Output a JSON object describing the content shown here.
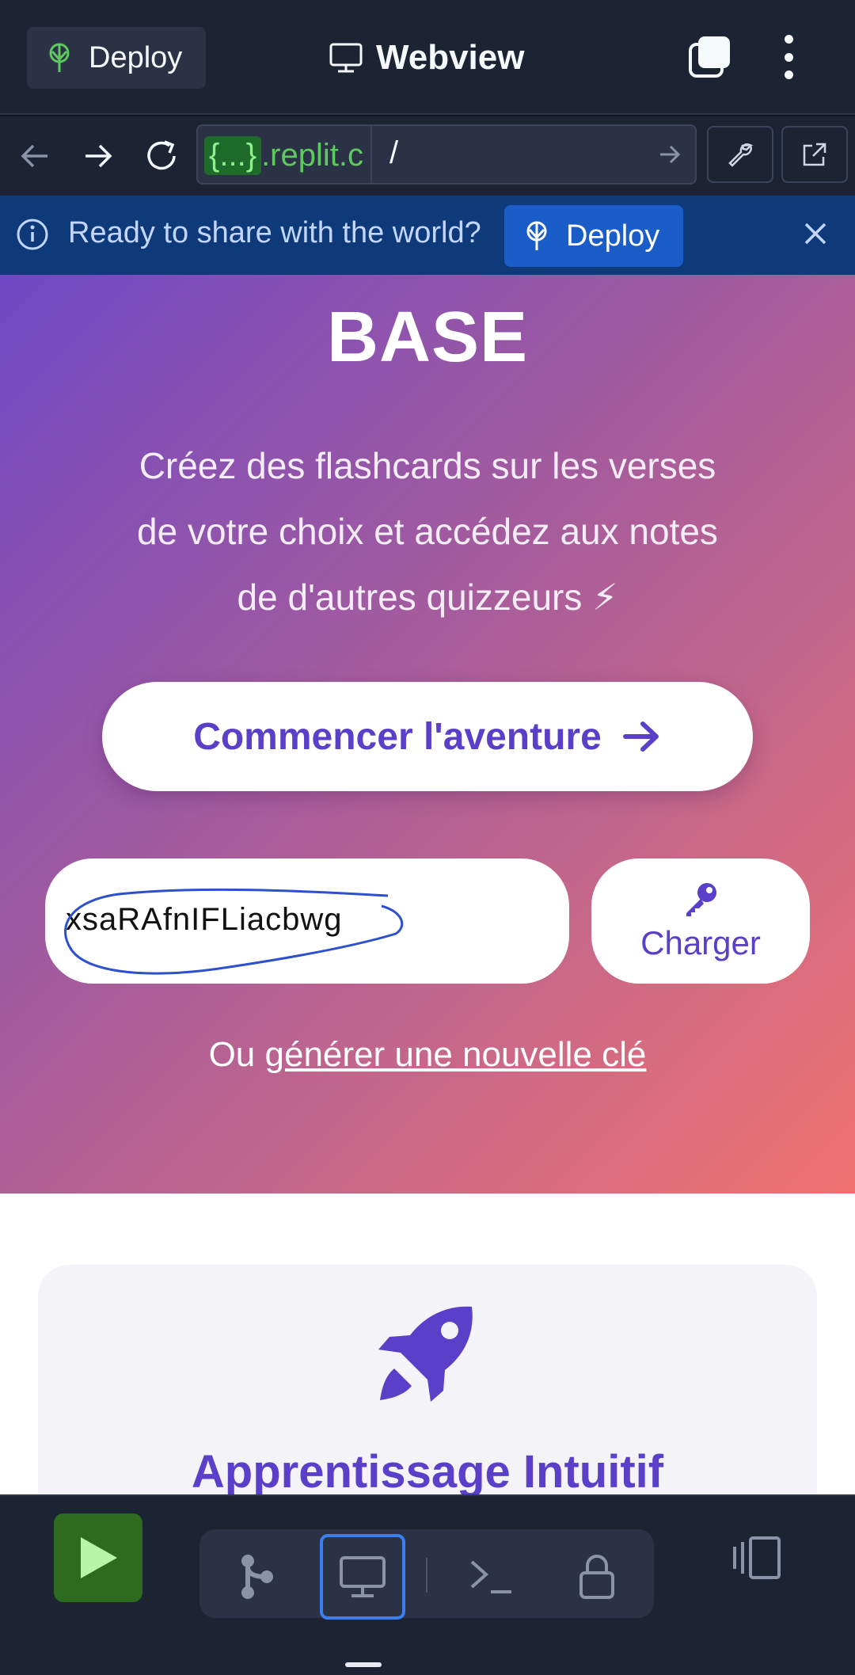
{
  "topbar": {
    "deploy_label": "Deploy",
    "title": "Webview",
    "icons": [
      "deploy-icon",
      "monitor-icon",
      "tabs-icon",
      "kebab-menu-icon"
    ]
  },
  "urlbar": {
    "host_brace": "{...}",
    "host_domain": ".replit.c",
    "path": "/",
    "icons": [
      "back-arrow-icon",
      "forward-arrow-icon",
      "refresh-icon",
      "go-arrow-icon",
      "wrench-icon",
      "open-external-icon"
    ]
  },
  "banner": {
    "message": "Ready to share with the world?",
    "deploy_label": "Deploy",
    "icons": [
      "info-icon",
      "deploy-icon",
      "close-icon"
    ]
  },
  "hero": {
    "title": "BASE",
    "subtitle_line1": "Créez des flashcards sur les verses",
    "subtitle_line2": "de votre choix et accédez aux notes",
    "subtitle_line3": "de d'autres quizzeurs ⚡",
    "cta_label": "Commencer l'aventure",
    "key_value": "xsaRAfnIFLiacbwg",
    "load_label": "Charger",
    "alt_prefix": "Ou ",
    "alt_link": "générer une nouvelle clé"
  },
  "feature": {
    "title": "Apprentissage Intuitif",
    "icon": "rocket-icon"
  },
  "dock": {
    "icons": [
      "run-icon",
      "git-icon",
      "webview-icon",
      "shell-icon",
      "secrets-lock-icon",
      "panels-icon"
    ],
    "accent": "#3a7ef0",
    "run_color": "#2d6b1e"
  },
  "colors": {
    "brand_purple": "#5a40c8",
    "banner_bg": "#0f3a7a",
    "chrome_bg": "#1c2333"
  }
}
